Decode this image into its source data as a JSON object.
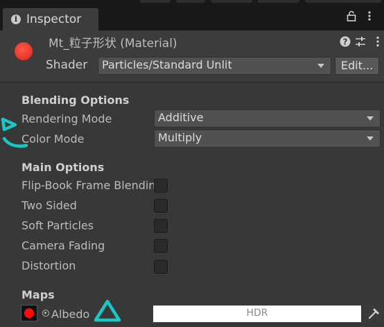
{
  "tab": {
    "title": "Inspector",
    "info_icon": "info-icon",
    "lock_icon": "lock-icon",
    "menu_icon": "menu-icon"
  },
  "material": {
    "title": "Mt_粒子形状 (Material)",
    "help_icon": "help-icon",
    "preset_icon": "preset-icon",
    "more_icon": "more-icon",
    "ball_color": "#e8392a"
  },
  "shader": {
    "label": "Shader",
    "value": "Particles/Standard Unlit",
    "edit_label": "Edit..."
  },
  "blending": {
    "heading": "Blending Options",
    "rendering_mode": {
      "label": "Rendering Mode",
      "value": "Additive"
    },
    "color_mode": {
      "label": "Color Mode",
      "value": "Multiply"
    }
  },
  "main_options": {
    "heading": "Main Options",
    "items": [
      {
        "label": "Flip-Book Frame Blending",
        "checked": false
      },
      {
        "label": "Two Sided",
        "checked": false
      },
      {
        "label": "Soft Particles",
        "checked": false
      },
      {
        "label": "Camera Fading",
        "checked": false
      },
      {
        "label": "Distortion",
        "checked": false
      }
    ]
  },
  "maps": {
    "heading": "Maps",
    "albedo": {
      "label": "Albedo",
      "color": "#ff0a0a",
      "hdr_label": "HDR"
    }
  },
  "colors": {
    "annotation": "#19c7c7",
    "background": "#383838",
    "header": "#3c3c3c"
  }
}
